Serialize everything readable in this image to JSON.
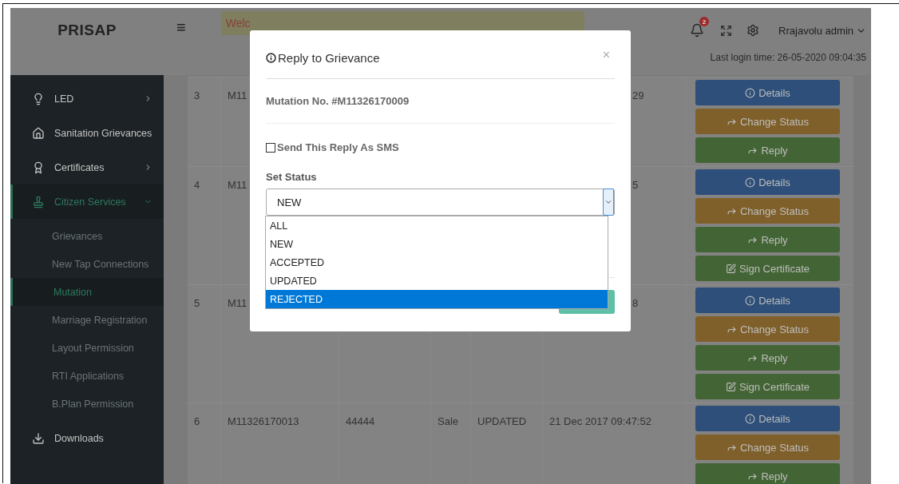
{
  "header": {
    "brand": "PRISAP",
    "menu_glyph": "≡",
    "welcome": "Welc",
    "notifications": "2",
    "user": "Rrajavolu admin",
    "last_login": "Last login time: 26-05-2020 09:04:35"
  },
  "sidebar": {
    "items": [
      {
        "label": "LED",
        "expanded": false,
        "selected": false
      },
      {
        "label": "Sanitation Grievances",
        "selected": false
      },
      {
        "label": "Certificates",
        "expanded": false,
        "selected": false
      },
      {
        "label": "Citizen Services",
        "expanded": true,
        "selected": true,
        "children": [
          {
            "label": "Grievances",
            "selected": false
          },
          {
            "label": "New Tap Connections",
            "selected": false
          },
          {
            "label": "Mutation",
            "selected": true
          },
          {
            "label": "Marriage Registration",
            "selected": false
          },
          {
            "label": "Layout Permission",
            "selected": false
          },
          {
            "label": "RTI Applications",
            "selected": false
          },
          {
            "label": "B.Plan Permission",
            "selected": false
          }
        ]
      },
      {
        "label": "Downloads",
        "selected": false
      }
    ]
  },
  "table": {
    "rows": [
      {
        "cells": [
          "3",
          "M11"
        ],
        "tail": "29",
        "actions": [
          {
            "kind": "details",
            "label": "Details"
          },
          {
            "kind": "status",
            "label": "Change Status"
          },
          {
            "kind": "reply",
            "label": "Reply"
          }
        ]
      },
      {
        "cells": [
          "4",
          "M11"
        ],
        "tail": "5",
        "actions": [
          {
            "kind": "details",
            "label": "Details"
          },
          {
            "kind": "status",
            "label": "Change Status"
          },
          {
            "kind": "reply",
            "label": "Reply"
          },
          {
            "kind": "sign",
            "label": "Sign Certificate"
          }
        ]
      },
      {
        "cells": [
          "5",
          "M11"
        ],
        "tail": "8",
        "actions": [
          {
            "kind": "details",
            "label": "Details"
          },
          {
            "kind": "status",
            "label": "Change Status"
          },
          {
            "kind": "reply",
            "label": "Reply"
          },
          {
            "kind": "sign",
            "label": "Sign Certificate"
          }
        ]
      },
      {
        "cells": [
          "6",
          "M11326170013",
          "44444",
          "Sale",
          "UPDATED",
          "21 Dec 2017 09:47:52"
        ],
        "actions": [
          {
            "kind": "details",
            "label": "Details"
          },
          {
            "kind": "status",
            "label": "Change Status"
          },
          {
            "kind": "reply",
            "label": "Reply"
          }
        ]
      }
    ]
  },
  "modal": {
    "title": "Reply to Grievance",
    "close": "×",
    "mutation": "Mutation No. #M11326170009",
    "sms": {
      "label": "Send This Reply As SMS",
      "checked": false
    },
    "status_label": "Set Status",
    "status_value": "NEW",
    "options": [
      {
        "label": "ALL",
        "selected": false
      },
      {
        "label": "NEW",
        "selected": false
      },
      {
        "label": "ACCEPTED",
        "selected": false
      },
      {
        "label": "UPDATED",
        "selected": false
      },
      {
        "label": "REJECTED",
        "selected": true
      }
    ]
  }
}
